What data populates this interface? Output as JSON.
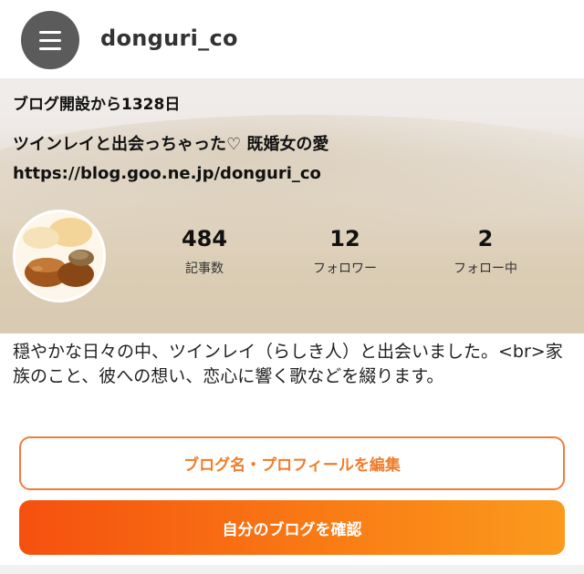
{
  "header": {
    "username": "donguri_co",
    "menu_icon": "hamburger-menu-icon"
  },
  "profile": {
    "days_since_open": "ブログ開設から1328日",
    "blog_title": "ツインレイと出会っちゃった♡ 既婚女の愛",
    "blog_url": "https://blog.goo.ne.jp/donguri_co",
    "avatar_icon": "acorn-avatar",
    "stats": [
      {
        "value": "484",
        "label": "記事数"
      },
      {
        "value": "12",
        "label": "フォロワー"
      },
      {
        "value": "2",
        "label": "フォロー中"
      }
    ]
  },
  "bio": "穏やかな日々の中、ツインレイ（らしき人）と出会いました。<br>家族のこと、彼への想い、恋心に響く歌などを綴ります。",
  "actions": {
    "edit_label": "ブログ名・プロフィールを編集",
    "view_label": "自分のブログを確認"
  },
  "colors": {
    "accent": "#ef7d2a",
    "button_gradient_start": "#f5500f",
    "button_gradient_end": "#fb9a1d",
    "menu_bg": "#5b5b5b"
  }
}
